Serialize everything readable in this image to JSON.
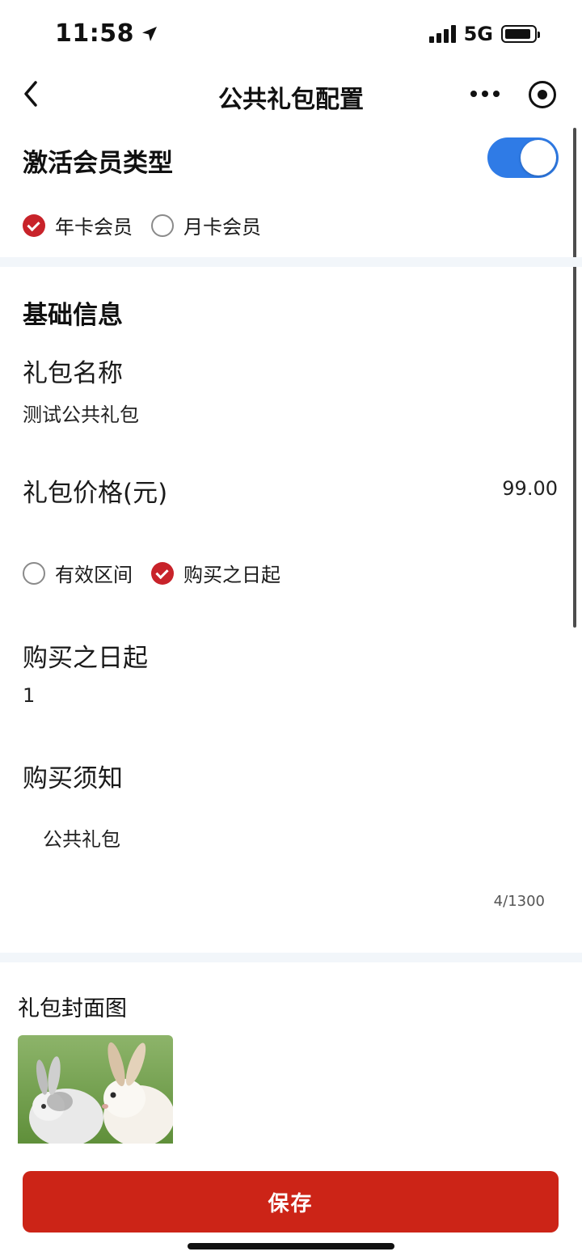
{
  "status_bar": {
    "time": "11:58",
    "network": "5G"
  },
  "nav": {
    "title": "公共礼包配置"
  },
  "member_type": {
    "title": "激活会员类型",
    "toggle_on": true,
    "options": [
      {
        "label": "年卡会员",
        "selected": true
      },
      {
        "label": "月卡会员",
        "selected": false
      }
    ]
  },
  "basic_info": {
    "title": "基础信息",
    "name_label": "礼包名称",
    "name_value": "测试公共礼包",
    "price_label": "礼包价格(元)",
    "price_value": "99.00",
    "validity_options": [
      {
        "label": "有效区间",
        "selected": false
      },
      {
        "label": "购买之日起",
        "selected": true
      }
    ],
    "from_purchase_label": "购买之日起",
    "from_purchase_value": "1",
    "notice_label": "购买须知",
    "notice_value": "公共礼包",
    "notice_counter": "4/1300"
  },
  "cover": {
    "label": "礼包封面图"
  },
  "actions": {
    "save_label": "保存"
  },
  "colors": {
    "accent_red": "#cc2417",
    "toggle_blue": "#2f7be6"
  }
}
